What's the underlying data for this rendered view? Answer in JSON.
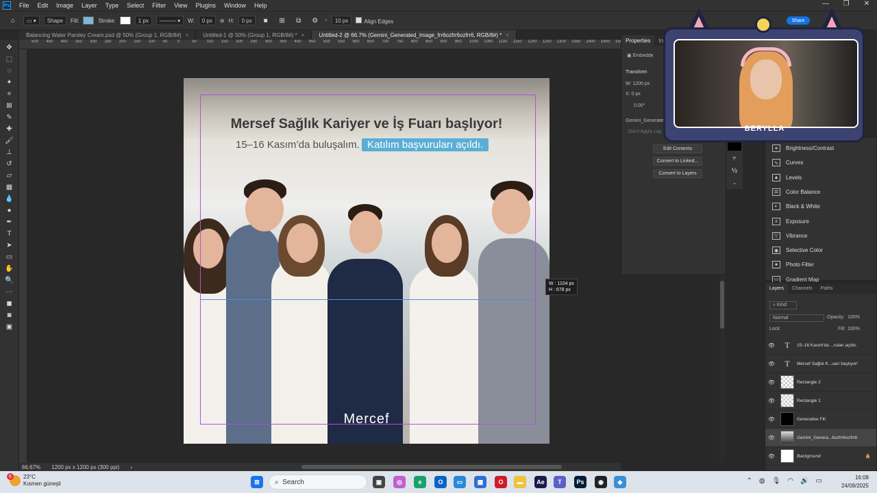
{
  "app": {
    "logo": "Ps"
  },
  "menu": [
    "File",
    "Edit",
    "Image",
    "Layer",
    "Type",
    "Select",
    "Filter",
    "View",
    "Plugins",
    "Window",
    "Help"
  ],
  "window_controls": {
    "minimize": "—",
    "maximize": "❐",
    "close": "✕"
  },
  "options": {
    "mode": "Shape",
    "fill_label": "Fill:",
    "fill_color": "#7bb8dc",
    "stroke_label": "Stroke:",
    "stroke_width": "1 px",
    "w_label": "W:",
    "w_value": "0 px",
    "h_label": "H:",
    "h_value": "0 px",
    "radius": "10 px",
    "align_edges": "Align Edges"
  },
  "tabs": [
    {
      "label": "Balancing Water Parsley Cream.psd @ 50% (Group 1, RGB/8#)",
      "close": "×"
    },
    {
      "label": "Untitled-1 @ 50% (Group 1, RGB/8#) *",
      "close": "×"
    },
    {
      "label": "Untitled-2 @ 66.7% (Gemini_Generated_Image_frr6ozfrr6ozfrr6, RGB/8#) *",
      "close": "×"
    }
  ],
  "ruler": [
    "500",
    "450",
    "400",
    "350",
    "300",
    "250",
    "200",
    "150",
    "100",
    "50",
    "0",
    "50",
    "100",
    "150",
    "200",
    "250",
    "300",
    "350",
    "400",
    "450",
    "500",
    "550",
    "600",
    "650",
    "700",
    "750",
    "800",
    "850",
    "900",
    "950",
    "1000",
    "1050",
    "1100",
    "1150",
    "1200",
    "1250",
    "1300",
    "1350",
    "1400",
    "1450",
    "1500"
  ],
  "artwork": {
    "headline": "Mersef Sağlık Kariyer ve İş Fuarı başlıyor!",
    "sub_plain": "15–16 Kasım’da buluşalım.",
    "sub_highlight": "Katılım başvuruları açıldı.",
    "logo": "Mercef"
  },
  "dimension_tip": {
    "w": "W :   1104 px",
    "h": "H :     678 px"
  },
  "status": {
    "zoom": "66.67%",
    "doc": "1200 px x 1200 px (300 ppi)",
    "arrow": "›"
  },
  "properties": {
    "tabs": [
      "Properties",
      "Ini"
    ],
    "embedded": "Embedde",
    "transform": "Transform",
    "w": "W:  1200 px",
    "x": "X:   0 px",
    "angle": "0.00°",
    "layer_name": "Gemini_Generate",
    "dont_apply": "Don't Apply Lay",
    "buttons": [
      "Edit Contents",
      "Convert to Linked...",
      "Convert to Layers"
    ]
  },
  "adjustments": [
    {
      "icon": "☀",
      "label": "Brightness/Contrast"
    },
    {
      "icon": "∿",
      "label": "Curves"
    },
    {
      "icon": "▲",
      "label": "Levels"
    },
    {
      "icon": "⚖",
      "label": "Color Balance"
    },
    {
      "icon": "◐",
      "label": "Black & White"
    },
    {
      "icon": "±",
      "label": "Exposure"
    },
    {
      "icon": "▽",
      "label": "Vibrance"
    },
    {
      "icon": "◉",
      "label": "Selective Color"
    },
    {
      "icon": "●",
      "label": "Photo Filter"
    },
    {
      "icon": "▭",
      "label": "Gradient Map"
    }
  ],
  "layers_panel": {
    "tabs": [
      "Layers",
      "Channels",
      "Paths"
    ],
    "kind": "Kind",
    "blend": "Normal",
    "opacity_label": "Opacity:",
    "opacity": "100%",
    "lock_label": "Lock:",
    "fill_label": "Fill:",
    "fill": "100%",
    "layers": [
      {
        "name": "15–16 Kasım'da ...ruları açıldı.",
        "thumb": "T"
      },
      {
        "name": "Mersef Sağlık K...uarı başlıyor!",
        "thumb": "T"
      },
      {
        "name": "Rectangle 2",
        "thumb": ""
      },
      {
        "name": "Rectangle 1",
        "thumb": ""
      },
      {
        "name": "Generative Fill",
        "thumb": ""
      },
      {
        "name": "Gemini_Genera...6ozfrr6ozfrr6",
        "thumb": ""
      },
      {
        "name": "Background",
        "thumb": ""
      }
    ]
  },
  "streamer": {
    "name": "BERYLLA"
  },
  "share": "Share",
  "taskbar": {
    "temp": "23°C",
    "weather": "Kısmen güneşli",
    "weather_badge": "6",
    "search_placeholder": "Search",
    "time": "16:08",
    "date": "24/09/2025"
  }
}
